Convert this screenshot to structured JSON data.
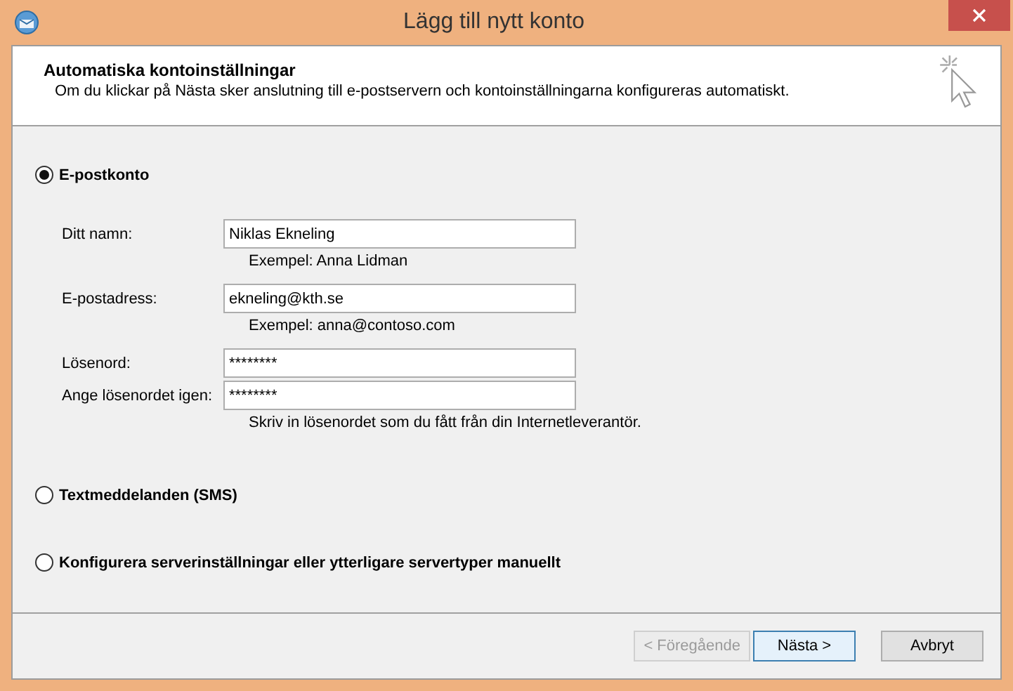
{
  "window": {
    "title": "Lägg till nytt konto"
  },
  "header": {
    "title": "Automatiska kontoinställningar",
    "description": "Om du klickar på Nästa sker anslutning till e-postservern och kontoinställningarna konfigureras automatiskt."
  },
  "options": [
    {
      "label": "E-postkonto",
      "selected": true,
      "fields": [
        {
          "label": "Ditt namn:",
          "value": "Niklas Ekneling",
          "hint": "Exempel: Anna Lidman"
        },
        {
          "label": "E-postadress:",
          "value": "ekneling@kth.se",
          "hint": "Exempel: anna@contoso.com"
        },
        {
          "label": "Lösenord:",
          "value": "********"
        },
        {
          "label": "Ange lösenordet igen:",
          "value": "********",
          "hint": "Skriv in lösenordet som du fått från din Internetleverantör."
        }
      ]
    },
    {
      "label": "Textmeddelanden (SMS)",
      "selected": false
    },
    {
      "label": "Konfigurera serverinställningar eller ytterligare servertyper manuellt",
      "selected": false
    }
  ],
  "buttons": [
    {
      "label": "< Föregående",
      "disabled": true,
      "default": false
    },
    {
      "label": "Nästa >",
      "disabled": false,
      "default": true
    },
    {
      "label": "Avbryt",
      "disabled": false,
      "default": false
    }
  ]
}
